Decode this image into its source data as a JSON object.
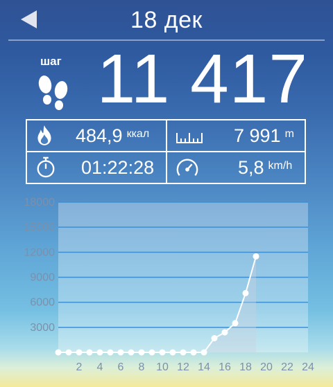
{
  "header": {
    "date": "18 дек"
  },
  "steps": {
    "label": "шаг",
    "value": "11 417"
  },
  "stats": {
    "calories": {
      "value": "484,9",
      "unit": "ккал"
    },
    "distance": {
      "value": "7 991",
      "unit": "m"
    },
    "duration": {
      "value": "01:22:28"
    },
    "speed": {
      "value": "5,8",
      "unit": "km/h"
    }
  },
  "chart_data": {
    "type": "line",
    "x": [
      0,
      1,
      2,
      3,
      4,
      5,
      6,
      7,
      8,
      9,
      10,
      11,
      12,
      13,
      14,
      15,
      16,
      17,
      18,
      19
    ],
    "y": [
      0,
      0,
      0,
      0,
      0,
      0,
      0,
      0,
      0,
      0,
      0,
      0,
      0,
      0,
      0,
      1700,
      2400,
      3500,
      7100,
      11500
    ],
    "xticks": [
      2,
      4,
      6,
      8,
      10,
      12,
      14,
      16,
      18,
      20,
      22,
      24
    ],
    "yticks": [
      3000,
      6000,
      9000,
      12000,
      15000,
      18000
    ],
    "xlim": [
      0,
      24
    ],
    "ylim": [
      0,
      18000
    ],
    "grid": true
  }
}
